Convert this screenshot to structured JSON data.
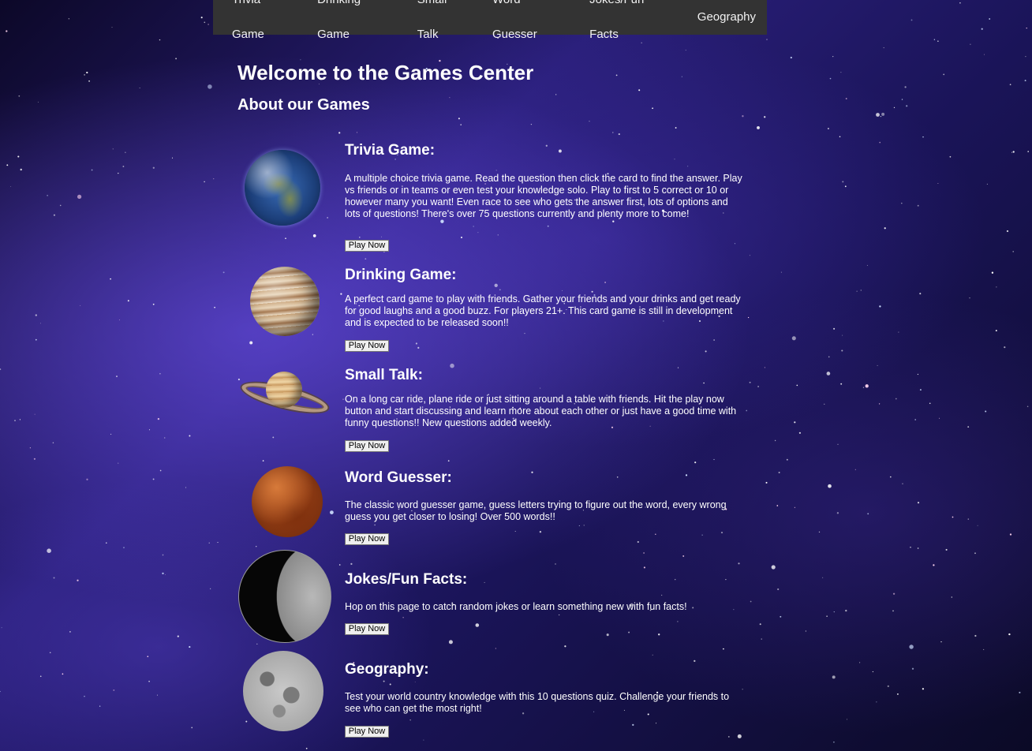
{
  "nav": {
    "items": [
      "Trivia Game",
      "Drinking Game",
      "Small Talk",
      "Word Guesser",
      "Jokes/Fun Facts",
      "Geography"
    ]
  },
  "header": {
    "title": "Welcome to the Games Center",
    "subtitle": "About our Games"
  },
  "games": [
    {
      "title": "Trivia Game:",
      "description": "A multiple choice trivia game. Read the question then click the card to find the answer. Play vs friends or in teams or even test your knowledge solo. Play to first to 5 correct or 10 or however many you want! Even race to see who gets the answer first, lots of options and lots of questions! There's over 75 questions currently and plenty more to come!",
      "button": "Play Now",
      "planet_icon": "earth-icon"
    },
    {
      "title": "Drinking Game:",
      "description": "A perfect card game to play with friends. Gather your friends and your drinks and get ready for good laughs and a good buzz. For players 21+. This card game is still in development and is expected to be released soon!!",
      "button": "Play Now",
      "planet_icon": "jupiter-icon"
    },
    {
      "title": "Small Talk:",
      "description": "On a long car ride, plane ride or just sitting around a table with friends. Hit the play now button and start discussing and learn more about each other or just have a good time with funny questions!! New questions added weekly.",
      "button": "Play Now",
      "planet_icon": "saturn-icon"
    },
    {
      "title": "Word Guesser:",
      "description": "The classic word guesser game, guess letters trying to figure out the word, every wrong guess you get closer to losing! Over 500 words!!",
      "button": "Play Now",
      "planet_icon": "mars-icon"
    },
    {
      "title": "Jokes/Fun Facts:",
      "description": "Hop on this page to catch random jokes or learn something new with fun facts!",
      "button": "Play Now",
      "planet_icon": "mercury-icon"
    },
    {
      "title": "Geography:",
      "description": "Test your world country knowledge with this 10 questions quiz. Challenge your friends to see who can get the most right!",
      "button": "Play Now",
      "planet_icon": "moon-icon"
    }
  ],
  "colors": {
    "navbar": "#333333",
    "text": "#ffffff",
    "background": "#2a1f7a"
  }
}
